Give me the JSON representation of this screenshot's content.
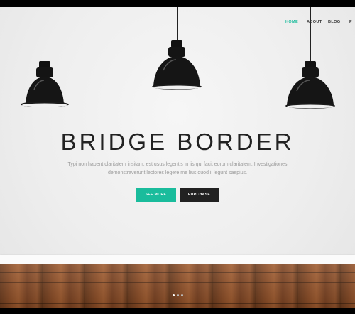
{
  "nav": {
    "items": [
      {
        "label": "HOME",
        "active": true
      },
      {
        "label": "ABOUT",
        "active": false
      },
      {
        "label": "BLOG",
        "active": false
      },
      {
        "label": "P",
        "active": false
      }
    ]
  },
  "hero": {
    "title": "BRIDGE BORDER",
    "subtitle": "Typi non habent claritatem insitam; est usus legentis in iis qui facit eorum claritatem. Investigationes demonstraverunt lectores legere me lius quod ii legunt saepius.",
    "primary_button": "SEE MORE",
    "secondary_button": "PURCHASE"
  },
  "slider": {
    "slide_count": 3,
    "active_index": 0
  },
  "colors": {
    "accent": "#1abc9c",
    "dark": "#222222",
    "wall": "#eeeeee",
    "floor": "#8a4b24"
  }
}
